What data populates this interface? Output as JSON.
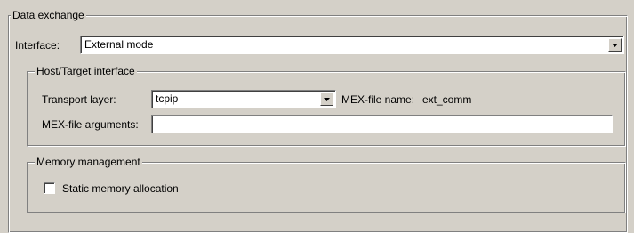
{
  "data_exchange": {
    "title": "Data exchange",
    "interface_label": "Interface:",
    "interface_value": "External mode"
  },
  "host_target": {
    "title": "Host/Target interface",
    "transport_label": "Transport layer:",
    "transport_value": "tcpip",
    "mex_file_name_label": "MEX-file name:",
    "mex_file_name_value": "ext_comm",
    "mex_args_label": "MEX-file arguments:",
    "mex_args_value": ""
  },
  "memory": {
    "title": "Memory management",
    "static_alloc_label": "Static memory allocation",
    "static_alloc_checked": false
  },
  "icons": {
    "dropdown": "chevron-down-icon"
  }
}
